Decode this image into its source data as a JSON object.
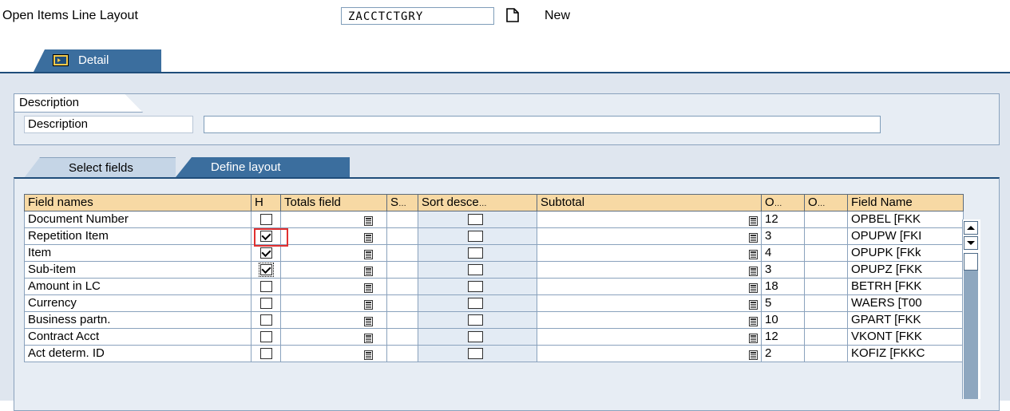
{
  "header": {
    "layout_label": "Open Items Line Layout",
    "layout_code": "ZACCTCTGRY",
    "new_label": "New"
  },
  "tabs": {
    "detail": "Detail"
  },
  "description_section": {
    "header": "Description",
    "field_label": "Description",
    "field_value": ""
  },
  "subtabs": {
    "select_fields": "Select fields",
    "define_layout": "Define layout"
  },
  "table": {
    "columns": [
      "Field names",
      "H",
      "Totals field",
      "S",
      "Sort desce",
      "Subtotal",
      "O",
      "O",
      "Field Name"
    ],
    "ellipsis": "…",
    "rows": [
      {
        "field": "Document Number",
        "h": false,
        "o1": "12",
        "name": "OPBEL  [FKK"
      },
      {
        "field": "Repetition Item",
        "h": true,
        "o1": "3",
        "name": "OPUPW  [FKI"
      },
      {
        "field": "Item",
        "h": true,
        "o1": "4",
        "name": "OPUPK  [FKk"
      },
      {
        "field": "Sub-item",
        "h": true,
        "o1": "3",
        "name": "OPUPZ  [FKK"
      },
      {
        "field": "Amount in LC",
        "h": false,
        "o1": "18",
        "name": "BETRH  [FKK"
      },
      {
        "field": "Currency",
        "h": false,
        "o1": "5",
        "name": "WAERS  [T00"
      },
      {
        "field": "Business partn.",
        "h": false,
        "o1": "10",
        "name": "GPART  [FKK"
      },
      {
        "field": "Contract Acct",
        "h": false,
        "o1": "12",
        "name": "VKONT  [FKK"
      },
      {
        "field": "Act determ. ID",
        "h": false,
        "o1": "2",
        "name": "KOFIZ  [FKKC"
      }
    ]
  },
  "colors": {
    "tab_active": "#3b6e9e",
    "header_cells": "#f7d9a4",
    "highlight": "#e03030",
    "panel_bg": "#dfe6ef"
  },
  "icons": [
    "new-document-icon",
    "detail-icon",
    "f4-help-icon",
    "scroll-up-icon",
    "scroll-down-icon"
  ]
}
